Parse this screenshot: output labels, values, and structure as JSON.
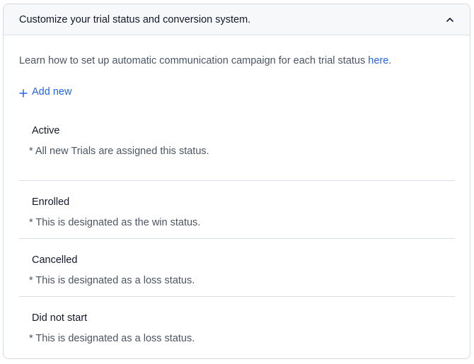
{
  "panel": {
    "title": "Customize your trial status and conversion system.",
    "collapse_icon": "chevron-up-icon"
  },
  "intro": {
    "text": "Learn how to set up automatic communication campaign for each trial status ",
    "link_label": "here",
    "suffix": "."
  },
  "add_new": {
    "icon": "plus-icon",
    "label": "Add new"
  },
  "statuses": [
    {
      "name": "Active",
      "note": "* All new Trials are assigned this status."
    },
    {
      "name": "Enrolled",
      "note": "* This is designated as the win status."
    },
    {
      "name": "Cancelled",
      "note": "* This is designated as a loss status."
    },
    {
      "name": "Did not start",
      "note": "* This is designated as a loss status."
    }
  ],
  "colors": {
    "accent": "#2563eb",
    "heading": "#111827",
    "muted": "#4b5563",
    "border": "#d9dde4",
    "header_bg": "#f7f8fa"
  }
}
